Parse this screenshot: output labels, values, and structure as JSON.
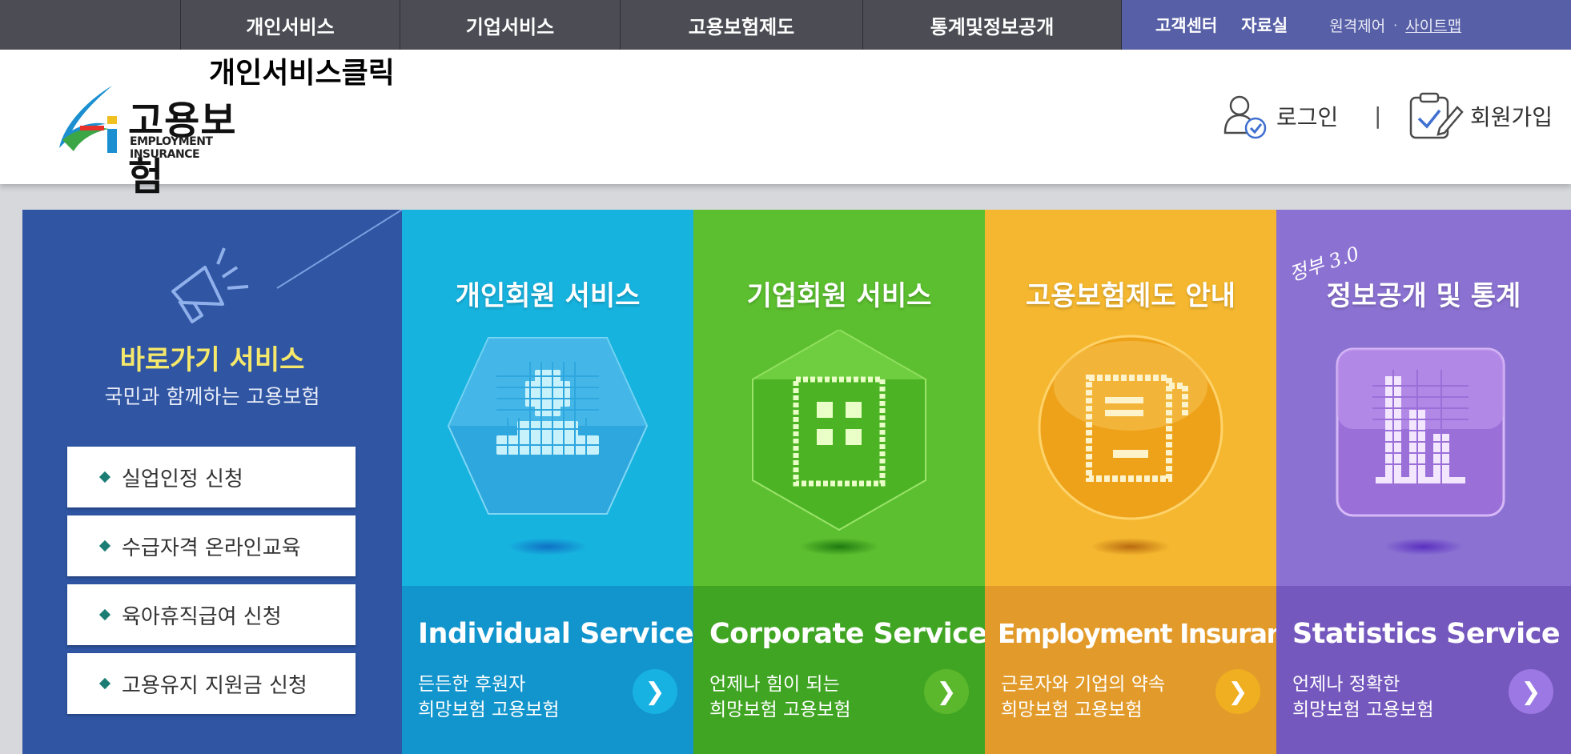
{
  "nav": {
    "items": [
      "개인서비스",
      "기업서비스",
      "고용보험제도",
      "통계및정보공개"
    ],
    "util": {
      "customer_center": "고객센터",
      "archive": "자료실",
      "remote": "원격제어",
      "separator": "·",
      "sitemap": "사이트맵"
    }
  },
  "header": {
    "skip_label": "개인서비스클릭",
    "logo_ko": "고용보험",
    "logo_en": "EMPLOYMENT INSURANCE",
    "login": "로그인",
    "separator": "|",
    "signup": "회원가입"
  },
  "quick": {
    "title": "바로가기 서비스",
    "subtitle": "국민과 함께하는 고용보험",
    "buttons": [
      "실업인정 신청",
      "수급자격 온라인교육",
      "육아휴직급여 신청",
      "고용유지 지원금 신청"
    ]
  },
  "services": [
    {
      "title": "개인회원 서비스",
      "en": "Individual Service",
      "line1": "든든한 후원자",
      "line2": "희망보험 고용보험",
      "icon": "person-icon",
      "color_top": "#17b3df",
      "color_bottom": "#1294cc",
      "arrow_color": "#18b2e2"
    },
    {
      "title": "기업회원 서비스",
      "en": "Corporate Service",
      "line1": "언제나 힘이 되는",
      "line2": "희망보험 고용보험",
      "icon": "building-icon",
      "color_top": "#5cbf2f",
      "color_bottom": "#41a524",
      "arrow_color": "#5bb82c"
    },
    {
      "title": "고용보험제도 안내",
      "en": "Employment Insurance",
      "line1": "근로자와 기업의 약속",
      "line2": "희망보험 고용보험",
      "icon": "document-icon",
      "color_top": "#f4b72f",
      "color_bottom": "#e29b2b",
      "arrow_color": "#efaf20"
    },
    {
      "title": "정보공개 및 통계",
      "en": "Statistics Service",
      "line1": "언제나 정확한",
      "line2": "희망보험 고용보험",
      "icon": "bar-chart-icon",
      "color_top": "#8b72d2",
      "color_bottom": "#7458bd",
      "arrow_color": "#9b78e3",
      "badge": "정부 3.0"
    }
  ],
  "colors": {
    "nav_bg": "#4c4c54",
    "nav_util_bg": "#575fa6",
    "quick_bg": "#2f55a3",
    "quick_title": "#f6e86a"
  }
}
